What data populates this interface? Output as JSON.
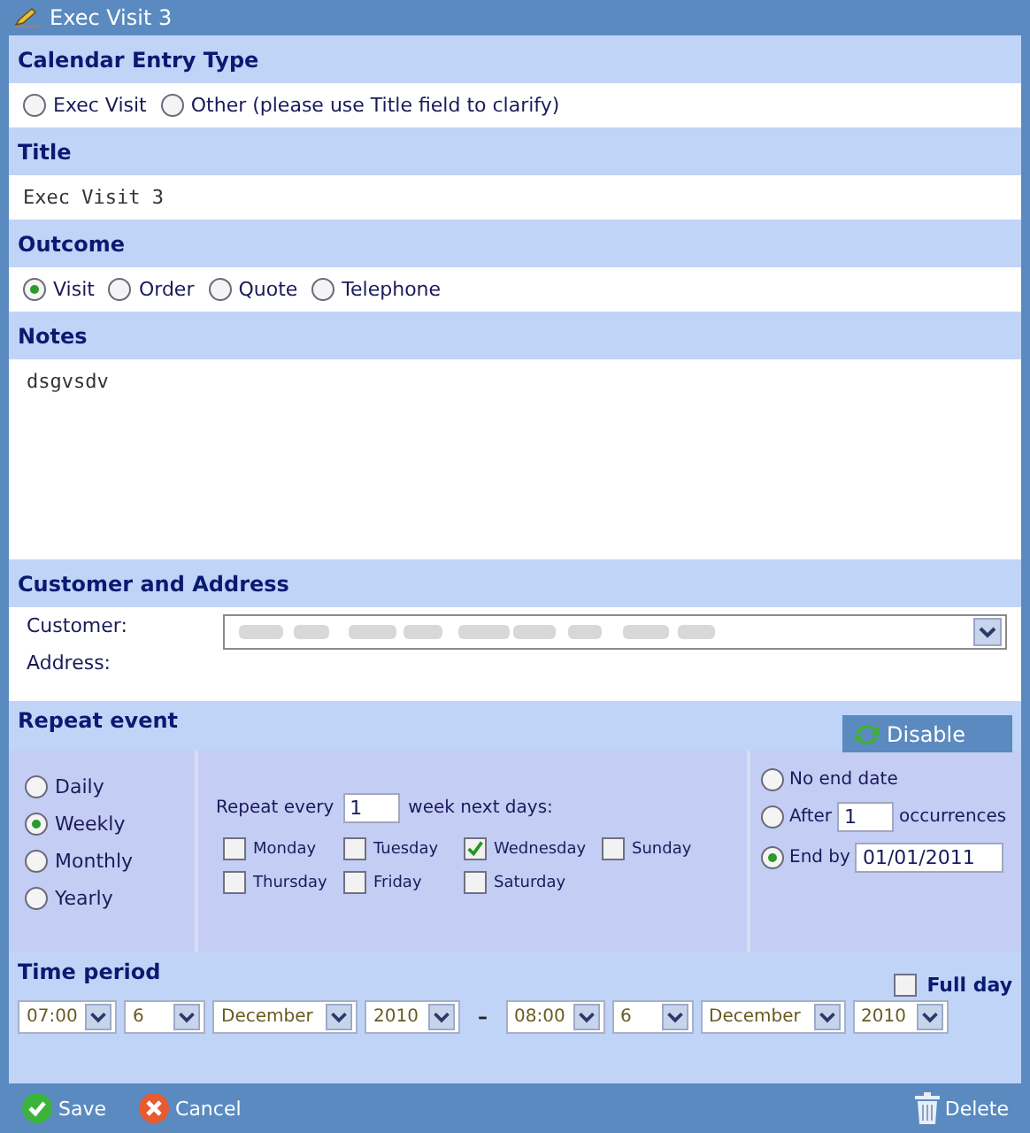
{
  "window": {
    "title": "Exec Visit 3"
  },
  "entry_type": {
    "heading": "Calendar Entry Type",
    "options": [
      {
        "label": "Exec Visit",
        "selected": false
      },
      {
        "label": "Other (please use Title field to clarify)",
        "selected": false
      }
    ]
  },
  "title": {
    "heading": "Title",
    "value": "Exec Visit 3"
  },
  "outcome": {
    "heading": "Outcome",
    "options": [
      {
        "label": "Visit",
        "selected": true
      },
      {
        "label": "Order",
        "selected": false
      },
      {
        "label": "Quote",
        "selected": false
      },
      {
        "label": "Telephone",
        "selected": false
      }
    ]
  },
  "notes": {
    "heading": "Notes",
    "value": "dsgvsdv"
  },
  "customer": {
    "heading": "Customer and Address",
    "customer_label": "Customer:",
    "address_label": "Address:"
  },
  "repeat": {
    "heading": "Repeat event",
    "toggle_button": "Disable",
    "frequency": [
      {
        "label": "Daily",
        "selected": false
      },
      {
        "label": "Weekly",
        "selected": true
      },
      {
        "label": "Monthly",
        "selected": false
      },
      {
        "label": "Yearly",
        "selected": false
      }
    ],
    "interval_prefix": "Repeat every",
    "interval_value": "1",
    "interval_suffix": "week next days:",
    "days": [
      {
        "label": "Monday",
        "checked": false
      },
      {
        "label": "Tuesday",
        "checked": false
      },
      {
        "label": "Wednesday",
        "checked": true
      },
      {
        "label": "Sunday",
        "checked": false
      },
      {
        "label": "Thursday",
        "checked": false
      },
      {
        "label": "Friday",
        "checked": false
      },
      {
        "label": "Saturday",
        "checked": false
      }
    ],
    "end": [
      {
        "kind": "none",
        "label": "No end date",
        "selected": false
      },
      {
        "kind": "after",
        "label": "After",
        "value": "1",
        "suffix": "occurrences",
        "selected": false
      },
      {
        "kind": "date",
        "label": "End by",
        "value": "01/01/2011",
        "selected": true
      }
    ]
  },
  "time_period": {
    "heading": "Time period",
    "full_day": {
      "label": "Full day",
      "checked": false
    },
    "start": [
      "07:00",
      "6",
      "December",
      "2010"
    ],
    "separator": "–",
    "end": [
      "08:00",
      "6",
      "December",
      "2010"
    ]
  },
  "footer": {
    "buttons": [
      {
        "kind": "save",
        "label": "Save"
      },
      {
        "kind": "cancel",
        "label": "Cancel"
      },
      {
        "kind": "delete",
        "label": "Delete"
      }
    ]
  }
}
